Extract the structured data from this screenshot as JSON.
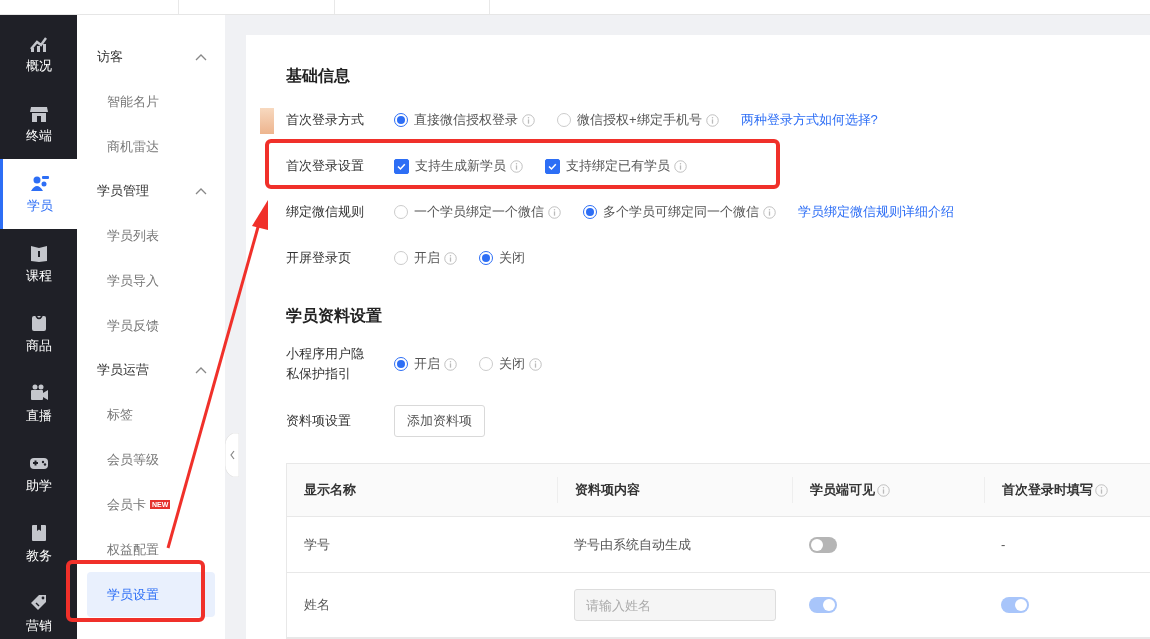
{
  "nav_rail": [
    {
      "label": "概况",
      "selected": false
    },
    {
      "label": "终端",
      "selected": false
    },
    {
      "label": "学员",
      "selected": true
    },
    {
      "label": "课程",
      "selected": false
    },
    {
      "label": "商品",
      "selected": false
    },
    {
      "label": "直播",
      "selected": false
    },
    {
      "label": "助学",
      "selected": false
    },
    {
      "label": "教务",
      "selected": false
    },
    {
      "label": "营销",
      "selected": false
    }
  ],
  "sub_menu": [
    {
      "title": "访客",
      "expanded": true,
      "items": [
        {
          "label": "智能名片",
          "selected": false
        },
        {
          "label": "商机雷达",
          "selected": false
        }
      ]
    },
    {
      "title": "学员管理",
      "expanded": true,
      "items": [
        {
          "label": "学员列表",
          "selected": false
        },
        {
          "label": "学员导入",
          "selected": false
        },
        {
          "label": "学员反馈",
          "selected": false
        }
      ]
    },
    {
      "title": "学员运营",
      "expanded": true,
      "items": [
        {
          "label": "标签",
          "selected": false
        },
        {
          "label": "会员等级",
          "selected": false
        },
        {
          "label": "会员卡",
          "selected": false,
          "badge": "NEW"
        },
        {
          "label": "权益配置",
          "selected": false
        },
        {
          "label": "学员设置",
          "selected": true
        }
      ]
    }
  ],
  "sections": [
    {
      "title": "基础信息",
      "rows": [
        {
          "kind": "radio",
          "label": "首次登录方式",
          "options": [
            {
              "label": "直接微信授权登录",
              "selected": true,
              "info": true
            },
            {
              "label": "微信授权+绑定手机号",
              "selected": false,
              "info": true
            }
          ],
          "link": "两种登录方式如何选择?"
        },
        {
          "kind": "checkbox",
          "label": "首次登录设置",
          "options": [
            {
              "label": "支持生成新学员",
              "checked": true,
              "info": true
            },
            {
              "label": "支持绑定已有学员",
              "checked": true,
              "info": true
            }
          ]
        },
        {
          "kind": "radio",
          "label": "绑定微信规则",
          "options": [
            {
              "label": "一个学员绑定一个微信",
              "selected": false,
              "info": true
            },
            {
              "label": "多个学员可绑定同一个微信",
              "selected": true,
              "info": true
            }
          ],
          "link": "学员绑定微信规则详细介绍"
        },
        {
          "kind": "radio",
          "label": "开屏登录页",
          "options": [
            {
              "label": "开启",
              "selected": false,
              "info": true
            },
            {
              "label": "关闭",
              "selected": true,
              "info": false
            }
          ]
        }
      ]
    },
    {
      "title": "学员资料设置",
      "rows": [
        {
          "kind": "radio",
          "label": "小程序用户隐私保护指引",
          "options": [
            {
              "label": "开启",
              "selected": true,
              "info": true
            },
            {
              "label": "关闭",
              "selected": false,
              "info": true
            }
          ]
        },
        {
          "kind": "button",
          "label": "资料项设置",
          "button": "添加资料项"
        }
      ]
    }
  ],
  "table": {
    "columns": [
      {
        "label": "显示名称",
        "info": false
      },
      {
        "label": "资料项内容",
        "info": false
      },
      {
        "label": "学员端可见",
        "info": true
      },
      {
        "label": "首次登录时填写",
        "info": true
      }
    ],
    "rows": [
      {
        "name": "学号",
        "content": {
          "kind": "text",
          "text": "学号由系统自动生成"
        },
        "visible": {
          "on": false
        },
        "first_login": {
          "kind": "text",
          "text": "-"
        }
      },
      {
        "name": "姓名",
        "content": {
          "kind": "input",
          "placeholder": "请输入姓名"
        },
        "visible": {
          "on": true
        },
        "first_login": {
          "kind": "toggle",
          "on": true
        }
      }
    ]
  }
}
